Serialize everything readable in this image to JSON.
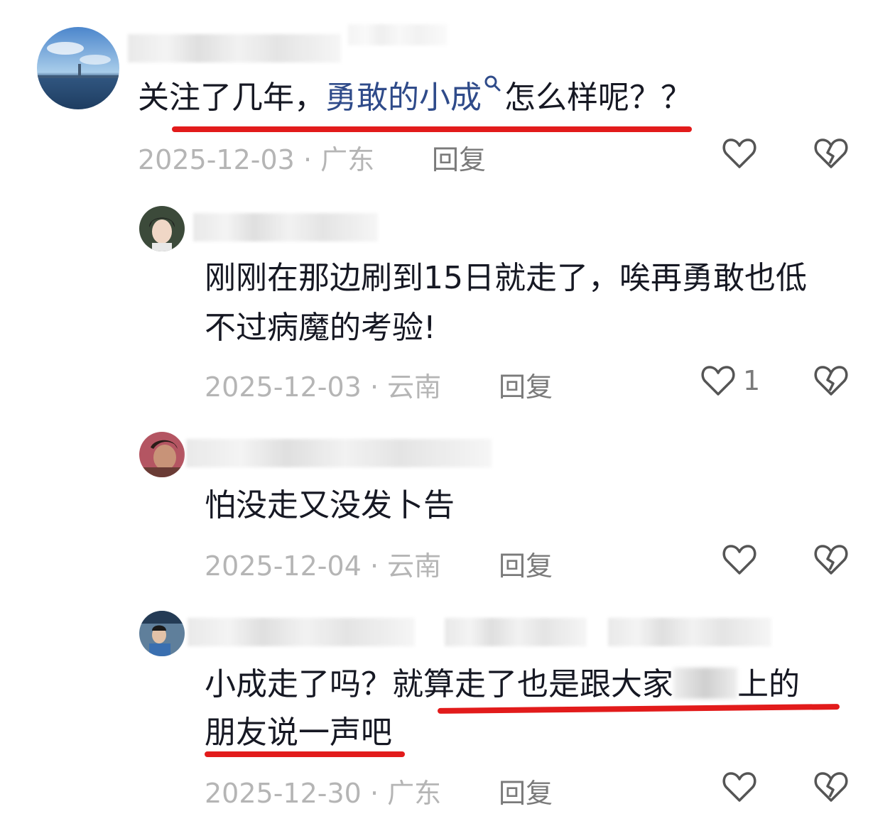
{
  "comments": [
    {
      "text_before": "关注了几年，",
      "link_text": "勇敢的小成",
      "text_after": "怎么样呢？？",
      "date": "2025-12-03",
      "region": "广东",
      "reply_label": "回复",
      "likes": ""
    },
    {
      "line1": "刚刚在那边刷到15日就走了，唉再勇敢也低",
      "line2": "不过病魔的考验!",
      "date": "2025-12-03",
      "region": "云南",
      "reply_label": "回复",
      "likes": "1"
    },
    {
      "line1": "怕没走又没发卜告",
      "date": "2025-12-04",
      "region": "云南",
      "reply_label": "回复",
      "likes": ""
    },
    {
      "line1_a": "小成走了吗？就算走了也是跟大家",
      "line1_b": "上的",
      "line2": "朋友说一声吧",
      "date": "2025-12-30",
      "region": "广东",
      "reply_label": "回复",
      "likes": ""
    }
  ],
  "separator": "·",
  "icons": {
    "like": "heart-outline-icon",
    "dislike": "broken-heart-icon",
    "search": "search-icon"
  },
  "colors": {
    "underline": "#e21b1b",
    "link": "#2f4b8a",
    "meta": "#b5b5b5"
  }
}
